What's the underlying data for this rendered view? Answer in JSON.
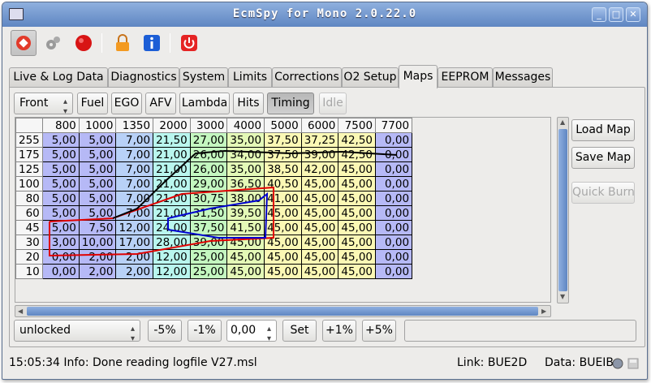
{
  "window": {
    "title": "EcmSpy for Mono 2.0.22.0"
  },
  "toolbar": {
    "icons": [
      "plug-icon",
      "gears-icon",
      "record-icon",
      "lock-icon",
      "info-icon",
      "power-icon"
    ]
  },
  "tabs": [
    {
      "label": "Live & Log Data"
    },
    {
      "label": "Diagnostics"
    },
    {
      "label": "System"
    },
    {
      "label": "Limits"
    },
    {
      "label": "Corrections"
    },
    {
      "label": "O2 Setup"
    },
    {
      "label": "Maps"
    },
    {
      "label": "EEPROM"
    },
    {
      "label": "Messages"
    }
  ],
  "maps": {
    "selector": "Front",
    "buttons": [
      "Fuel",
      "EGO",
      "AFV",
      "Lambda",
      "Hits",
      "Timing",
      "Idle"
    ],
    "side_buttons": {
      "load": "Load Map",
      "save": "Save Map",
      "quick_burn": "Quick Burn"
    },
    "columns": [
      "800",
      "1000",
      "1350",
      "2000",
      "3000",
      "4000",
      "5000",
      "6000",
      "7500",
      "7700"
    ],
    "rows": [
      {
        "load": "255",
        "values": [
          "5,00",
          "5,00",
          "7,00",
          "21,50",
          "27,00",
          "35,00",
          "37,50",
          "37,25",
          "42,50",
          "0,00"
        ]
      },
      {
        "load": "175",
        "values": [
          "5,00",
          "5,00",
          "7,00",
          "21,00",
          "26,00",
          "34,00",
          "37,50",
          "39,00",
          "42,50",
          "0,00"
        ]
      },
      {
        "load": "125",
        "values": [
          "5,00",
          "5,00",
          "7,00",
          "21,00",
          "26,00",
          "35,00",
          "38,50",
          "42,00",
          "45,00",
          "0,00"
        ]
      },
      {
        "load": "100",
        "values": [
          "5,00",
          "5,00",
          "7,00",
          "21,00",
          "29,00",
          "36,50",
          "40,50",
          "45,00",
          "45,00",
          "0,00"
        ]
      },
      {
        "load": "80",
        "values": [
          "5,00",
          "5,00",
          "7,00",
          "21,00",
          "30,75",
          "38,00",
          "41,00",
          "45,00",
          "45,00",
          "0,00"
        ]
      },
      {
        "load": "60",
        "values": [
          "5,00",
          "5,00",
          "7,00",
          "21,00",
          "31,50",
          "39,50",
          "45,00",
          "45,00",
          "45,00",
          "0,00"
        ]
      },
      {
        "load": "45",
        "values": [
          "5,00",
          "7,50",
          "12,00",
          "24,00",
          "37,50",
          "41,50",
          "45,00",
          "45,00",
          "45,00",
          "0,00"
        ]
      },
      {
        "load": "30",
        "values": [
          "3,00",
          "10,00",
          "17,00",
          "28,00",
          "39,00",
          "45,00",
          "45,00",
          "45,00",
          "45,00",
          "0,00"
        ]
      },
      {
        "load": "20",
        "values": [
          "0,00",
          "2,00",
          "2,00",
          "12,00",
          "25,00",
          "45,00",
          "45,00",
          "45,00",
          "45,00",
          "0,00"
        ]
      },
      {
        "load": "10",
        "values": [
          "0,00",
          "2,00",
          "2,00",
          "12,00",
          "25,00",
          "45,00",
          "45,00",
          "45,00",
          "45,00",
          "0,00"
        ]
      }
    ],
    "column_colors": [
      "#b6b9f6",
      "#b6b9f6",
      "#b8d1f7",
      "#b9f6ee",
      "#c4f7c0",
      "#e4f9b7",
      "#fbf8b5",
      "#fbf8b5",
      "#fbf8b5",
      "#b6b9f6"
    ]
  },
  "controls": {
    "lock_state": "unlocked",
    "minus5": "-5%",
    "minus1": "-1%",
    "value": "0,00",
    "set": "Set",
    "plus1": "+1%",
    "plus5": "+5%"
  },
  "status": {
    "message": "15:05:34 Info: Done reading logfile V27.msl",
    "link": "Link: BUE2D",
    "data": "Data: BUEIB"
  }
}
